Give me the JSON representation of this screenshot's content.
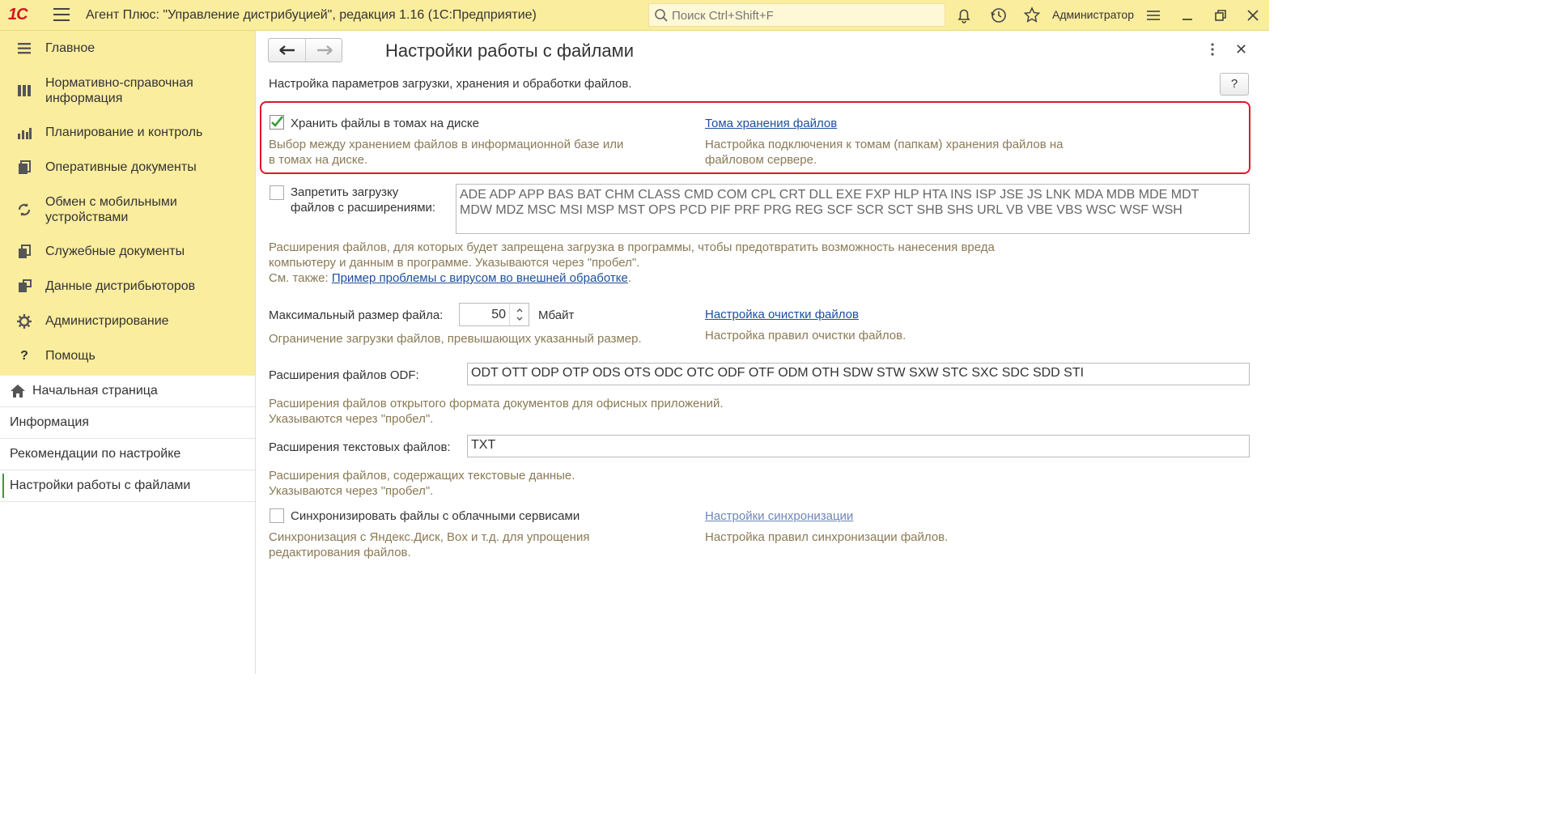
{
  "topbar": {
    "logo": "1С",
    "title": "Агент Плюс: \"Управление дистрибуцией\", редакция 1.16  (1С:Предприятие)",
    "search_placeholder": "Поиск Ctrl+Shift+F",
    "user": "Администратор"
  },
  "sidebar": {
    "sections": [
      {
        "label": "Главное",
        "icon": "menu-lines-icon"
      },
      {
        "label": "Нормативно-справочная информация",
        "icon": "catalog-icon"
      },
      {
        "label": "Планирование и контроль",
        "icon": "bar-chart-icon"
      },
      {
        "label": "Оперативные документы",
        "icon": "documents-icon"
      },
      {
        "label": "Обмен с мобильными устройствами",
        "icon": "sync-icon"
      },
      {
        "label": "Служебные документы",
        "icon": "service-docs-icon"
      },
      {
        "label": "Данные дистрибьюторов",
        "icon": "distributor-data-icon"
      },
      {
        "label": "Администрирование",
        "icon": "gear-icon"
      },
      {
        "label": "Помощь",
        "icon": "question-icon"
      }
    ],
    "open_windows": [
      {
        "label": "Начальная страница"
      },
      {
        "label": "Информация"
      },
      {
        "label": "Рекомендации по настройке"
      },
      {
        "label": "Настройки работы с файлами"
      }
    ]
  },
  "form": {
    "title": "Настройки работы с файлами",
    "subtitle": "Настройка параметров загрузки, хранения и обработки файлов.",
    "help": "?",
    "store_volumes": {
      "label": "Хранить файлы в томах на диске",
      "checked": true,
      "hint_line1": "Выбор между хранением файлов в информационной базе или",
      "hint_line2": "в томах на диске.",
      "link": "Тома хранения файлов",
      "link_hint_line1": "Настройка подключения к томам (папкам) хранения файлов на",
      "link_hint_line2": "файловом сервере."
    },
    "deny_upload": {
      "label_line1": "Запретить загрузку",
      "label_line2": "файлов с расширениями:",
      "checked": false,
      "value_line1": "ADE ADP APP BAS BAT CHM CLASS CMD COM CPL CRT DLL EXE FXP HLP HTA INS ISP JSE JS LNK MDA MDB MDE MDT",
      "value_line2": "MDW MDZ MSC MSI MSP MST OPS PCD PIF PRF PRG REG SCF SCR SCT SHB SHS URL VB VBE VBS WSC WSF WSH",
      "hint_line1": "Расширения файлов, для которых будет запрещена загрузка в  программы, чтобы предотвратить возможность нанесения вреда",
      "hint_line2": "компьютеру и  данным в программе. Указываются через \"пробел\".",
      "see_also": "См. также: ",
      "see_also_link": "Пример проблемы с вирусом во внешней  обработке",
      "see_also_end": "."
    },
    "max_size": {
      "label": "Максимальный размер файла:",
      "value": "50",
      "unit": "Мбайт",
      "hint": "Ограничение загрузки файлов, превышающих указанный размер.",
      "link": "Настройка очистки файлов",
      "link_hint": "Настройка правил очистки файлов."
    },
    "odf": {
      "label": "Расширения файлов ODF:",
      "value": "ODT OTT ODP OTP ODS OTS ODC OTC ODF OTF ODM OTH SDW STW SXW STC SXC SDC SDD STI",
      "hint_line1": "Расширения файлов открытого формата документов для офисных приложений.",
      "hint_line2": "Указываются через \"пробел\"."
    },
    "text_ext": {
      "label": "Расширения текстовых файлов:",
      "value": "TXT",
      "hint_line1": "Расширения файлов, содержащих текстовые данные.",
      "hint_line2": "Указываются через \"пробел\"."
    },
    "cloud_sync": {
      "label": "Синхронизировать файлы с облачными сервисами",
      "checked": false,
      "hint_line1": "Синхронизация с Яндекс.Диск, Box и т.д. для упрощения",
      "hint_line2": "редактирования файлов.",
      "link": "Настройки синхронизации",
      "link_hint": "Настройка правил синхронизации файлов."
    }
  },
  "colors": {
    "topbar": "#fbed9e",
    "highlight": "#e0162b",
    "link": "#1c4f9c",
    "hint": "#8a7a55",
    "check": "#3a9b3a"
  }
}
